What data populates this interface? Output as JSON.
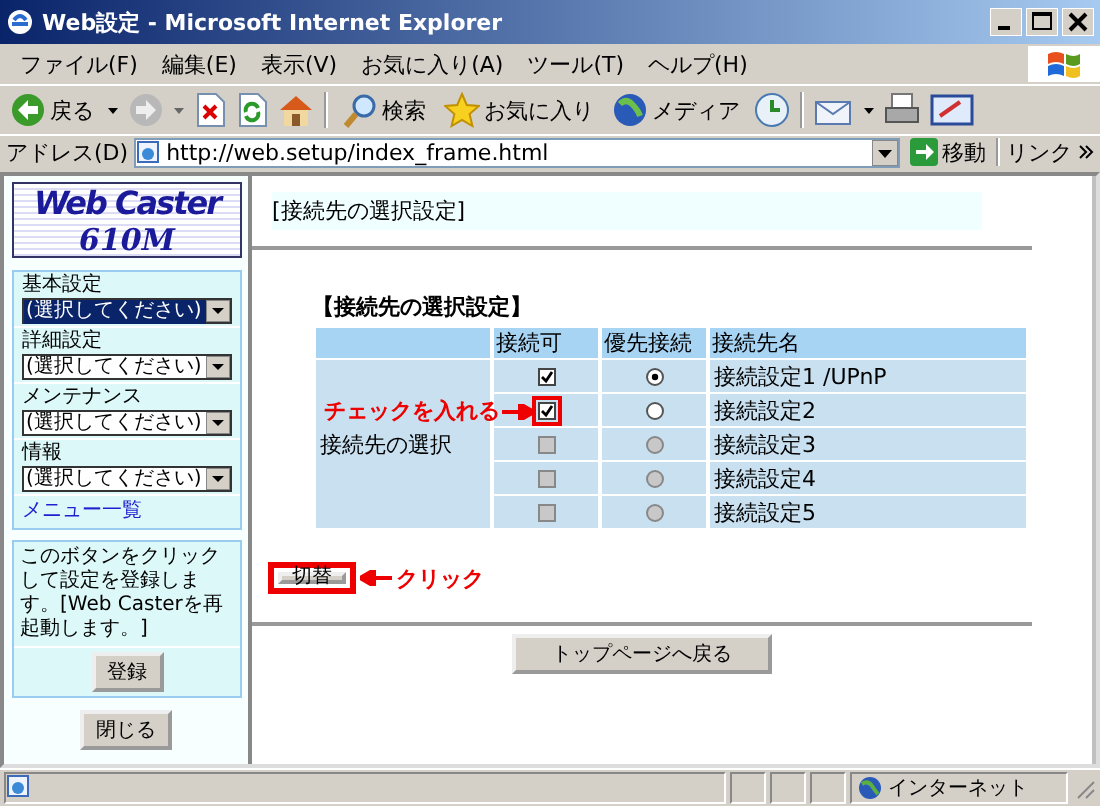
{
  "window": {
    "title": "Web設定 - Microsoft Internet Explorer"
  },
  "menu": [
    "ファイル(F)",
    "編集(E)",
    "表示(V)",
    "お気に入り(A)",
    "ツール(T)",
    "ヘルプ(H)"
  ],
  "toolbar": {
    "back": "戻る",
    "search": "検索",
    "favorites": "お気に入り",
    "media": "メディア"
  },
  "address": {
    "label": "アドレス(D)",
    "value": "http://web.setup/index_frame.html",
    "go": "移動",
    "links": "リンク"
  },
  "sidebar": {
    "logo": {
      "line1": "Web Caster",
      "line2": "610M"
    },
    "groups": [
      {
        "label": "基本設定",
        "select": "(選択してください)",
        "focused": true
      },
      {
        "label": "詳細設定",
        "select": "(選択してください)",
        "focused": false
      },
      {
        "label": "メンテナンス",
        "select": "(選択してください)",
        "focused": false
      },
      {
        "label": "情報",
        "select": "(選択してください)",
        "focused": false
      }
    ],
    "menu_link": "メニュー一覧",
    "note": "このボタンをクリックして設定を登録します。[Web Casterを再起動します。]",
    "register_button": "登録",
    "close_button": "閉じる"
  },
  "main": {
    "header": "[接続先の選択設定]",
    "section_title": "【接続先の選択設定】",
    "table": {
      "columns": [
        "接続可",
        "優先接続",
        "接続先名"
      ],
      "row_header": "接続先の選択",
      "rows": [
        {
          "enabled": true,
          "selected": true,
          "disabled": false,
          "name": "接続設定1 /UPnP"
        },
        {
          "enabled": true,
          "selected": false,
          "disabled": false,
          "name": "接続設定2",
          "callout": "チェックを入れる"
        },
        {
          "enabled": false,
          "selected": false,
          "disabled": true,
          "name": "接続設定3"
        },
        {
          "enabled": false,
          "selected": false,
          "disabled": true,
          "name": "接続設定4"
        },
        {
          "enabled": false,
          "selected": false,
          "disabled": true,
          "name": "接続設定5"
        }
      ]
    },
    "switch_button": {
      "label": "切替",
      "callout": "クリック"
    },
    "top_button": "トップページへ戻る"
  },
  "status_bar": {
    "zone": "インターネット"
  }
}
